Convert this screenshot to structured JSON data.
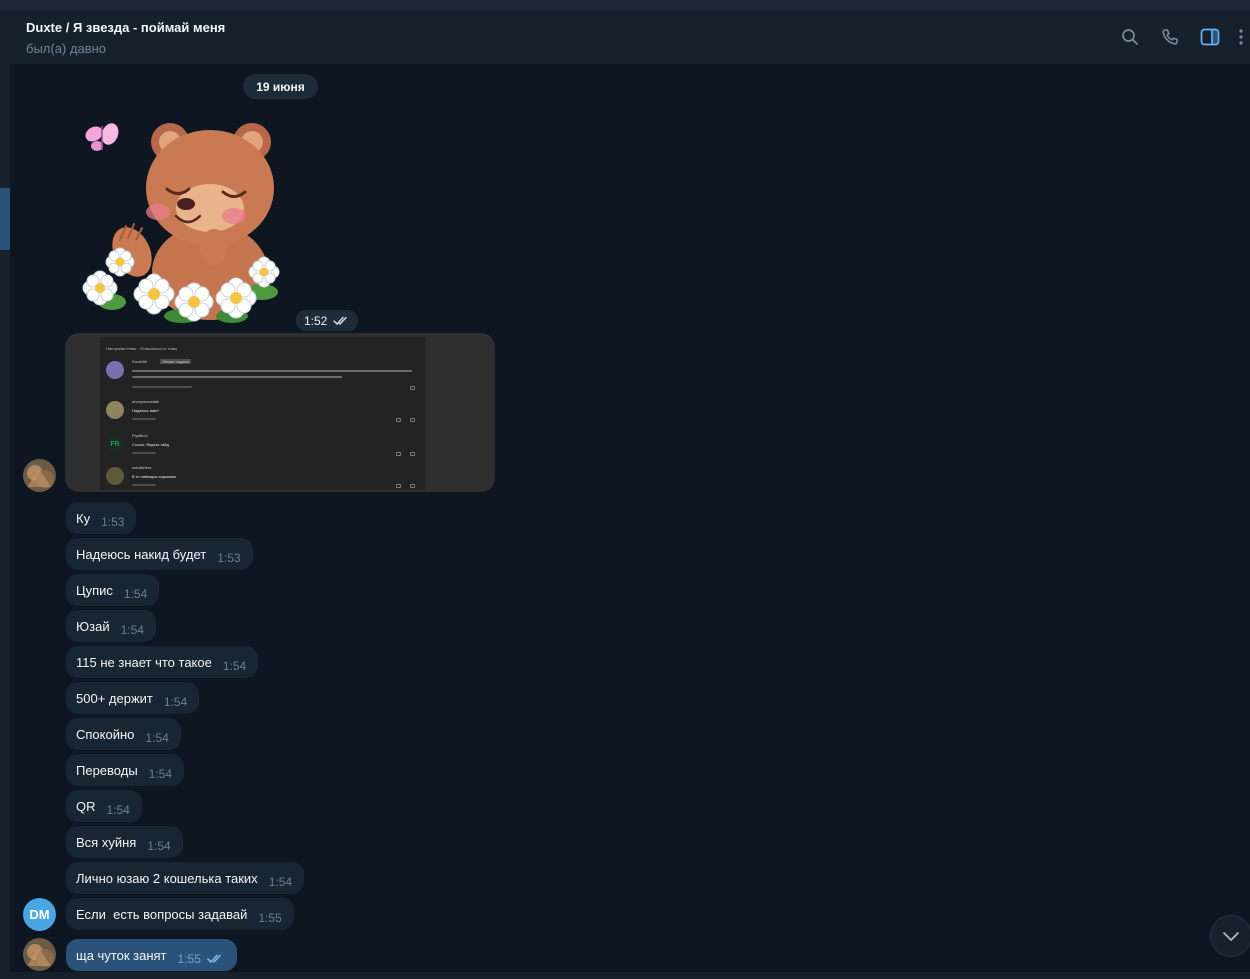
{
  "header": {
    "title": "Duxte / Я звезда - поймай меня",
    "status": "был(а) давно"
  },
  "icons": {
    "search": "search-icon",
    "call": "phone-icon",
    "panel": "sidebar-toggle-icon",
    "menu": "more-vertical-icon",
    "scroll": "chevron-down-icon",
    "read": "double-check-icon"
  },
  "date_separator": "19 июня",
  "sticker": {
    "time": "1:52"
  },
  "screenshot": {
    "header": "Настройки темы  ·  Отписаться от темы",
    "user1": "Duxte56",
    "user1_tag": "Лёгкие подачи",
    "user2": "anonymoustalk",
    "user2_text": "Надеюсь вам?",
    "user3": "FlyaBro1",
    "user3_text": "Ссылк: Яндекс гайд",
    "user3_initials": "FR",
    "user4": "avtofishers",
    "user4_text": "В гп наёмщик подскажи"
  },
  "messages": [
    {
      "text": "Ку",
      "time": "1:53"
    },
    {
      "text": "Надеюсь накид будет",
      "time": "1:53"
    },
    {
      "text": "Цупис",
      "time": "1:54"
    },
    {
      "text": "Юзай",
      "time": "1:54"
    },
    {
      "text": "115 не знает что такое",
      "time": "1:54"
    },
    {
      "text": "500+ держит",
      "time": "1:54"
    },
    {
      "text": "Спокойно",
      "time": "1:54"
    },
    {
      "text": "Переводы",
      "time": "1:54"
    },
    {
      "text": "QR",
      "time": "1:54"
    },
    {
      "text": "Вся хуйня",
      "time": "1:54"
    },
    {
      "text": "Лично юзаю 2 кошелька таких",
      "time": "1:54"
    },
    {
      "text": "Если  есть вопросы задавай",
      "time": "1:55"
    }
  ],
  "dm_avatar": "DM",
  "outgoing": {
    "text": "ща чуток занят",
    "time": "1:55"
  },
  "colors": {
    "background": "#0e1621",
    "header": "#17212b",
    "incoming_bubble": "#182533",
    "outgoing_bubble": "#2b5278",
    "accent": "#5eb5f7",
    "online": "#31c56a"
  }
}
